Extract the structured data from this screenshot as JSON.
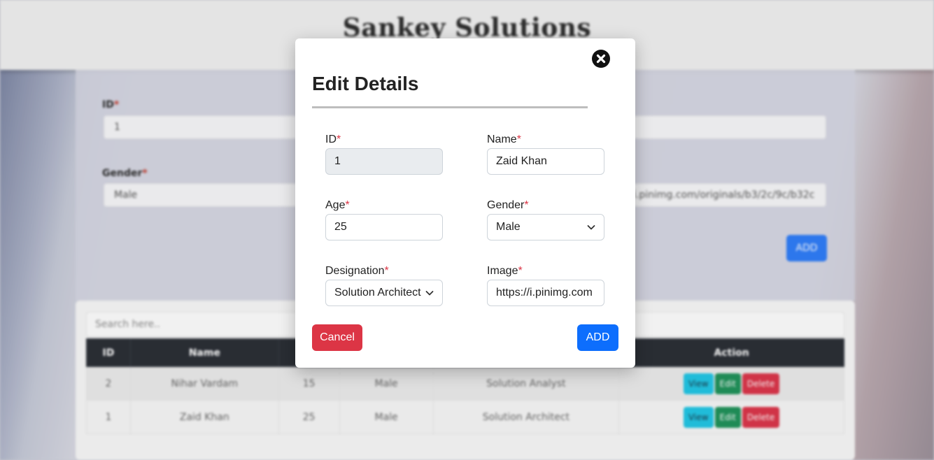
{
  "app": {
    "title": "Sankey Solutions"
  },
  "background_form": {
    "id_label": "ID",
    "id_value": "1",
    "gender_label": "Gender",
    "gender_value": "Male",
    "image_value": "i.pinimg.com/originals/b3/2c/9c/b32c",
    "add_label": "ADD"
  },
  "table": {
    "search_placeholder": "Search here..",
    "headers": [
      "ID",
      "Name",
      "",
      "",
      "",
      "Action"
    ],
    "rows": [
      {
        "id": "2",
        "name": "Nihar Vardam",
        "age": "15",
        "gender": "Male",
        "designation": "Solution Analyst"
      },
      {
        "id": "1",
        "name": "Zaid Khan",
        "age": "25",
        "gender": "Male",
        "designation": "Solution Architect"
      }
    ],
    "actions": {
      "view": "View",
      "edit": "Edit",
      "delete": "Delete"
    }
  },
  "modal": {
    "title": "Edit Details",
    "fields": {
      "id": {
        "label": "ID",
        "value": "1"
      },
      "name": {
        "label": "Name",
        "value": "Zaid Khan"
      },
      "age": {
        "label": "Age",
        "value": "25"
      },
      "gender": {
        "label": "Gender",
        "value": "Male"
      },
      "designation": {
        "label": "Designation",
        "value": "Solution Architect"
      },
      "image": {
        "label": "Image",
        "value": "https://i.pinimg.com"
      }
    },
    "required_marker": "*",
    "cancel_label": "Cancel",
    "add_label": "ADD"
  },
  "colors": {
    "danger": "#dc3545",
    "primary": "#0d6efd",
    "header_dark": "#2b2f36"
  }
}
